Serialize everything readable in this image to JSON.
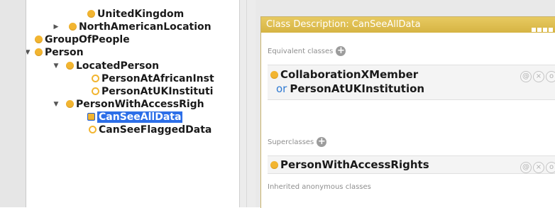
{
  "class_tree": {
    "items": [
      {
        "label": "UnitedKingdom",
        "toggle": "",
        "icon": "class-icon"
      },
      {
        "label": "NorthAmericanLocation",
        "toggle": "▶",
        "icon": "class-icon"
      },
      {
        "label": "GroupOfPeople",
        "toggle": "",
        "icon": "class-icon"
      },
      {
        "label": "Person",
        "toggle": "▼",
        "icon": "class-icon"
      },
      {
        "label": "LocatedPerson",
        "toggle": "▼",
        "icon": "class-icon"
      },
      {
        "label": "PersonAtAfricanInst",
        "toggle": "",
        "icon": "defined-class-icon"
      },
      {
        "label": "PersonAtUKInstituti",
        "toggle": "",
        "icon": "defined-class-icon"
      },
      {
        "label": "PersonWithAccessRigh",
        "toggle": "▼",
        "icon": "class-icon"
      },
      {
        "label": "CanSeeAllData",
        "toggle": "",
        "icon": "defined-class-icon",
        "selected": true
      },
      {
        "label": "CanSeeFlaggedData",
        "toggle": "",
        "icon": "defined-class-icon"
      }
    ]
  },
  "class_description": {
    "title": "Class Description: CanSeeAllData",
    "equivalent_label": "Equivalent classes",
    "equivalent": {
      "first": "CollaborationXMember",
      "operator": "or",
      "second": "PersonAtUKInstitution"
    },
    "superclasses_label": "Superclasses",
    "superclass": "PersonWithAccessRights",
    "inherited_label": "Inherited anonymous classes"
  },
  "colors": {
    "class_dot": "#f2b531",
    "header": "#d9b84a",
    "selection": "#2c6ee8",
    "or_keyword": "#2f7ad2"
  }
}
